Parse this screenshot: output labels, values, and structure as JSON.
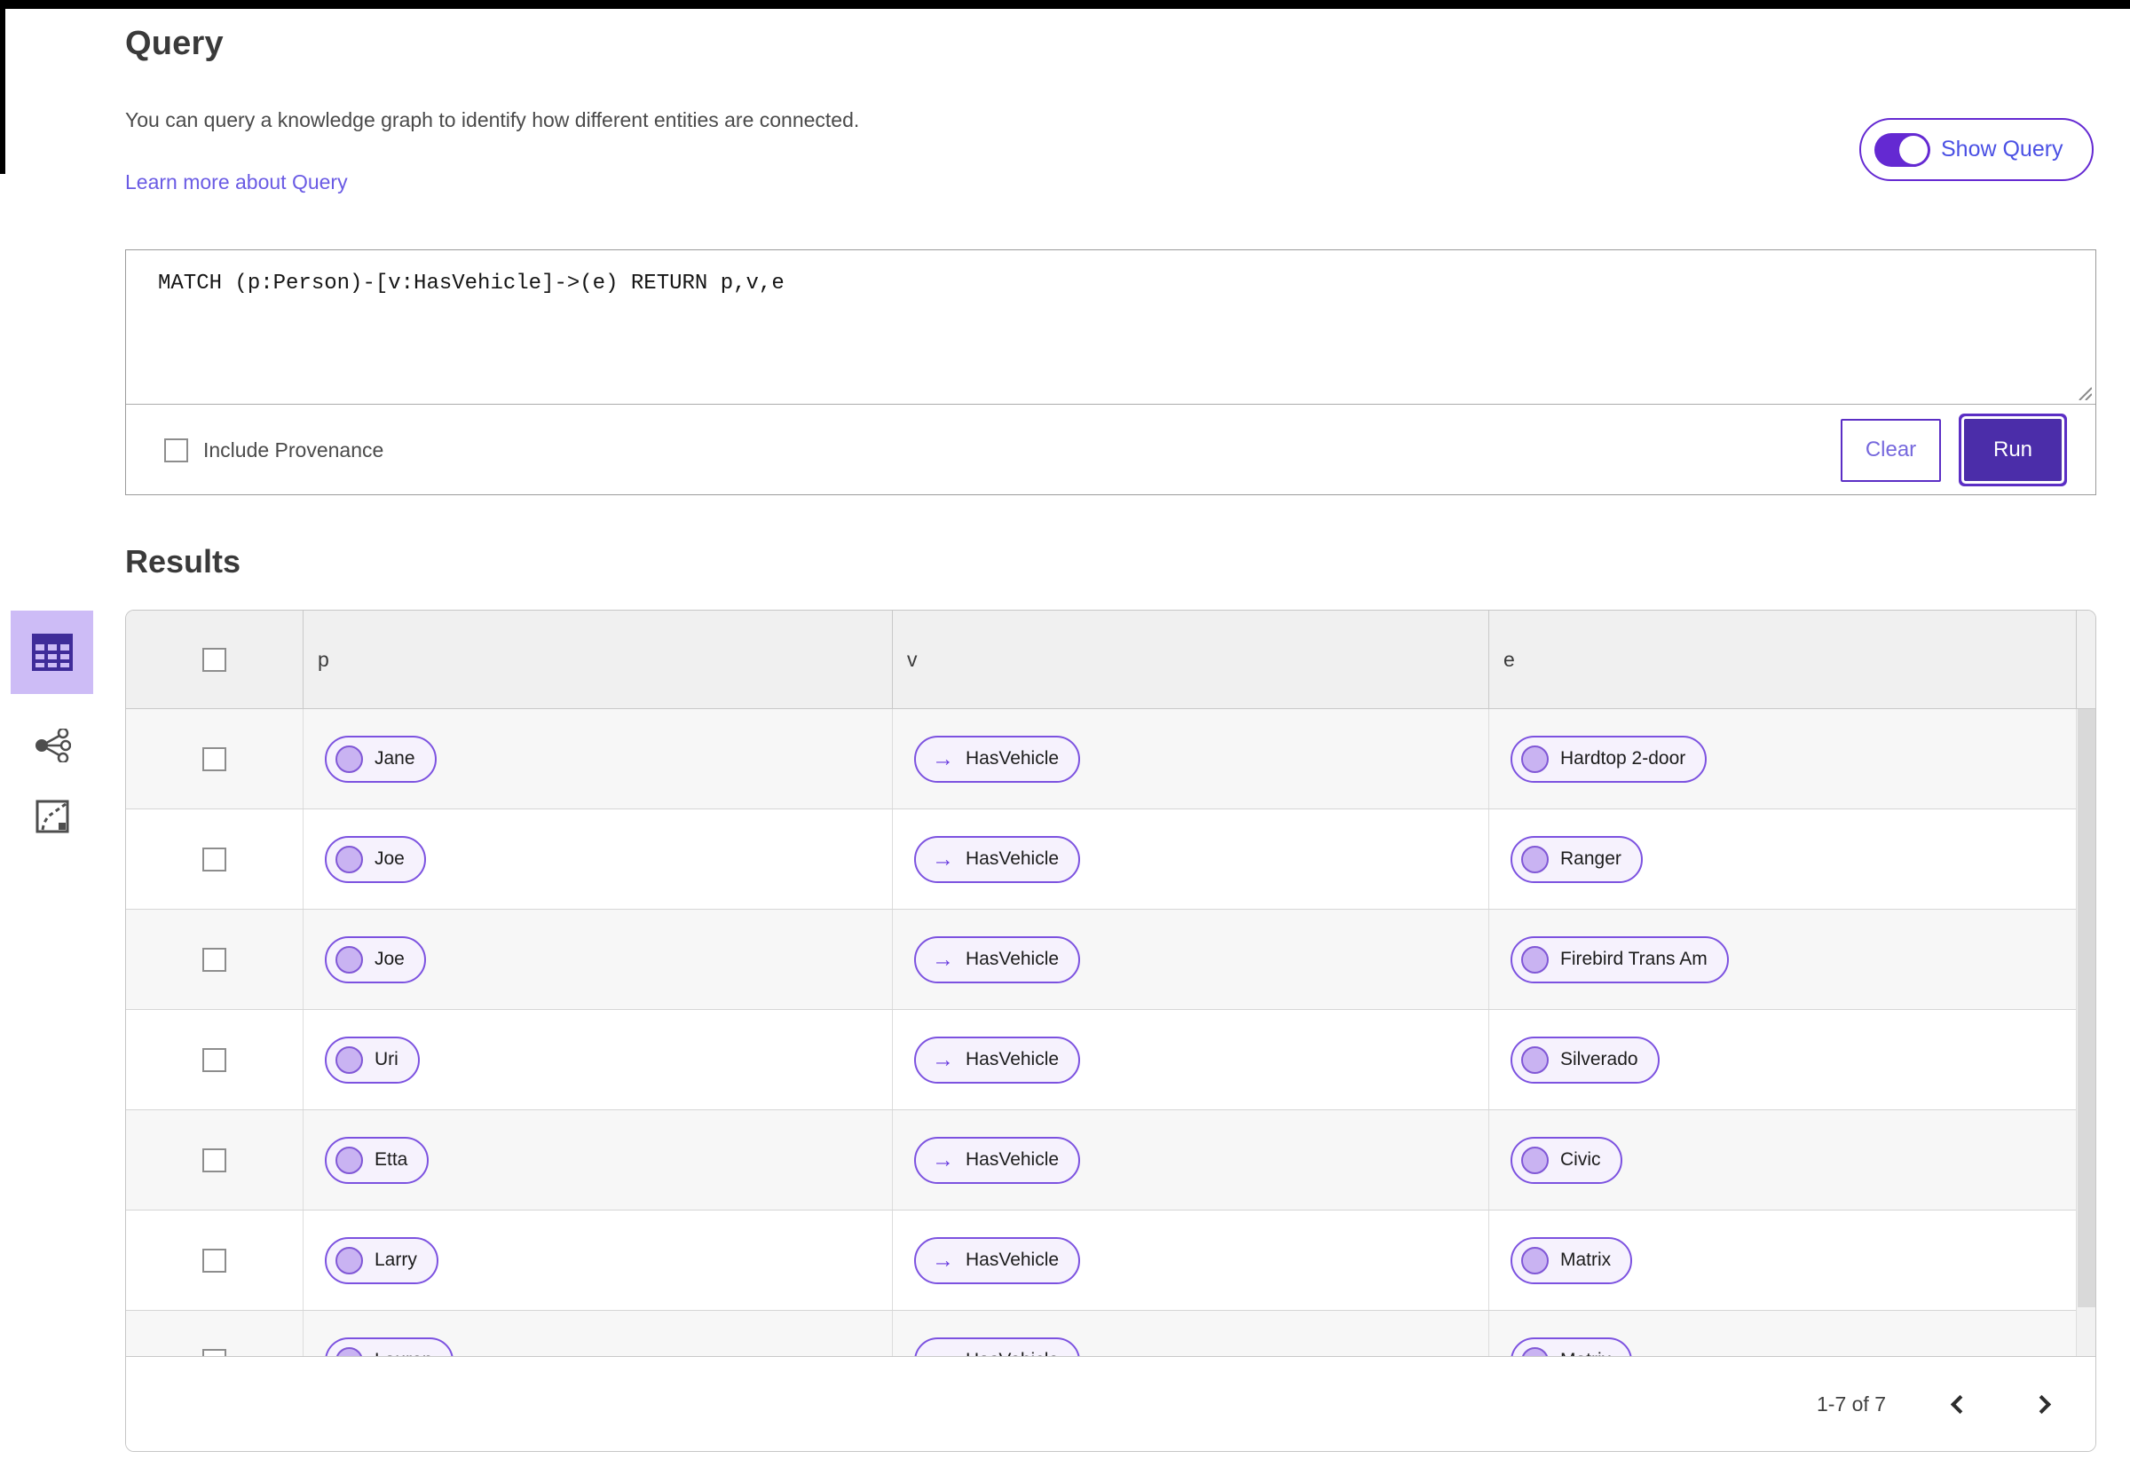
{
  "header": {
    "title": "Query",
    "description": "You can query a knowledge graph to identify how different entities are connected.",
    "learn_more_link": "Learn more about Query",
    "show_query_label": "Show Query",
    "show_query_on": true
  },
  "query_editor": {
    "query_text": "MATCH (p:Person)-[v:HasVehicle]->(e) RETURN p,v,e",
    "include_provenance_label": "Include Provenance",
    "include_provenance_checked": false,
    "clear_button": "Clear",
    "run_button": "Run"
  },
  "results": {
    "title": "Results",
    "columns": [
      "p",
      "v",
      "e"
    ],
    "relation_arrow": "→",
    "rows": [
      {
        "p": "Jane",
        "v": "HasVehicle",
        "e": "Hardtop 2-door"
      },
      {
        "p": "Joe",
        "v": "HasVehicle",
        "e": "Ranger"
      },
      {
        "p": "Joe",
        "v": "HasVehicle",
        "e": "Firebird Trans Am"
      },
      {
        "p": "Uri",
        "v": "HasVehicle",
        "e": "Silverado"
      },
      {
        "p": "Etta",
        "v": "HasVehicle",
        "e": "Civic"
      },
      {
        "p": "Larry",
        "v": "HasVehicle",
        "e": "Matrix"
      },
      {
        "p": "Lauren",
        "v": "HasVehicle",
        "e": "Matrix"
      }
    ],
    "pagination": {
      "range_label": "1-7 of 7"
    },
    "view_switcher": {
      "selected": "table-view",
      "views": [
        "table-view",
        "graph-view",
        "map-view"
      ]
    }
  },
  "colors": {
    "accent_purple": "#5b2ec5",
    "run_button_bg": "#4b2da9",
    "toggle_fill": "#6429d2",
    "toggle_label": "#4a50e4",
    "link": "#6a5be4",
    "selected_tile_bg": "#cdbcf6",
    "selected_icon": "#3f2c99",
    "chip_border": "#7c52e0",
    "chip_bg": "#f6f2fd",
    "chip_circle_fill": "#c9b3f2",
    "header_bg": "#f0f0f0",
    "row_alt_bg": "#f7f7f7"
  }
}
